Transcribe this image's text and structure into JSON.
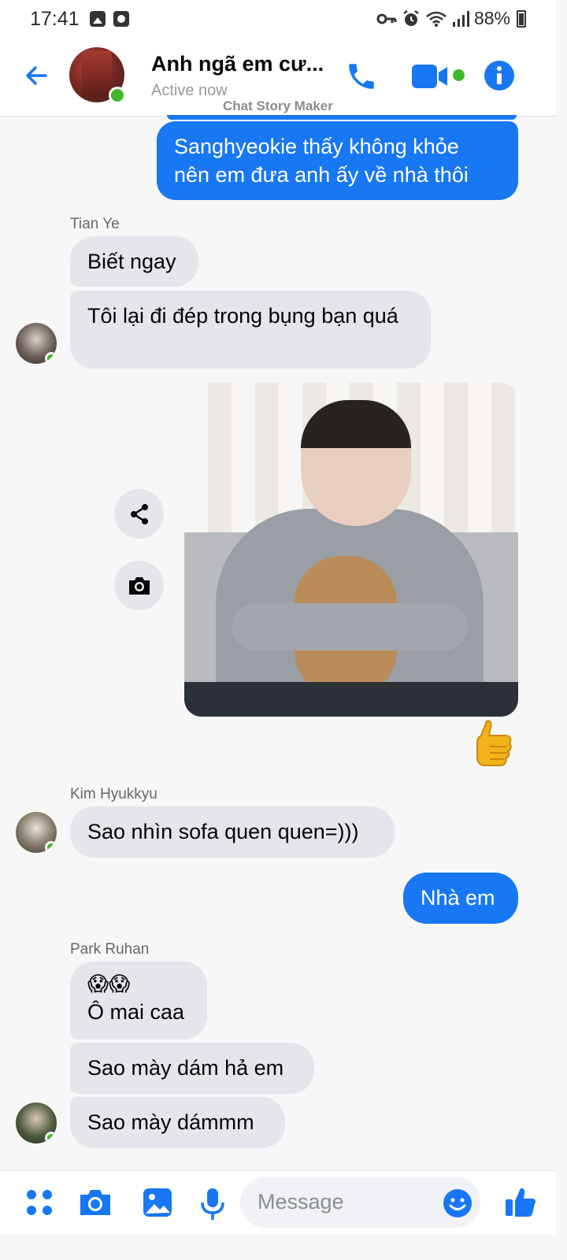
{
  "status_bar": {
    "time": "17:41",
    "battery": "88%"
  },
  "header": {
    "title": "Anh ngã em cư...",
    "status": "Active now",
    "watermark": "Chat Story Maker"
  },
  "colors": {
    "brand": "#1877f2",
    "online": "#42b72a",
    "incoming_bubble": "#e4e6eb"
  },
  "messages": [
    {
      "side": "out",
      "text_lines": [
        "Sanghyeokie thấy không khỏe",
        "nên em đưa anh ấy về nhà thôi"
      ]
    },
    {
      "side": "in",
      "sender": "Tian Ye",
      "text": "Biết ngay"
    },
    {
      "side": "in",
      "text": "Tôi lại đi đép trong bụng bạn quá"
    },
    {
      "side": "out",
      "type": "photo"
    },
    {
      "side": "out",
      "type": "thumbs-up-emoji"
    },
    {
      "side": "in",
      "sender": "Kim Hyukkyu",
      "text": "Sao nhìn sofa quen quen=)))"
    },
    {
      "side": "out",
      "text": "Nhà em"
    },
    {
      "side": "in",
      "sender": "Park Ruhan",
      "emoji": "😱😱",
      "text": "Ô mai caa"
    },
    {
      "side": "in",
      "text": "Sao mày dám hả em"
    },
    {
      "side": "in",
      "text": "Sao mày dámmm"
    }
  ],
  "composer": {
    "placeholder": "Message"
  }
}
